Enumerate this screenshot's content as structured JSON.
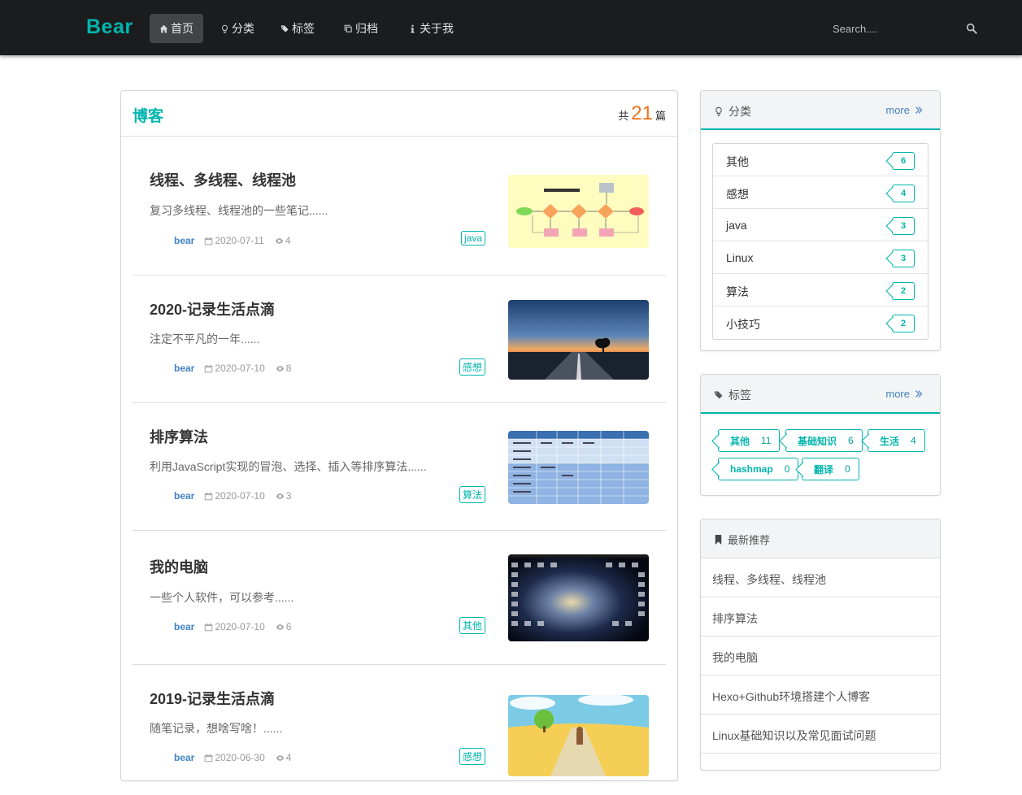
{
  "header": {
    "brand": "Bear",
    "nav": [
      {
        "label": "首页",
        "icon": "home-icon",
        "active": true
      },
      {
        "label": "分类",
        "icon": "lightbulb-icon"
      },
      {
        "label": "标签",
        "icon": "tags-icon"
      },
      {
        "label": "归档",
        "icon": "clone-icon"
      },
      {
        "label": "关于我",
        "icon": "info-icon"
      }
    ],
    "search_placeholder": "Search....",
    "search_icon": "search-icon"
  },
  "blog": {
    "title": "博客",
    "count_prefix": "共",
    "count": "21",
    "count_suffix": "篇",
    "posts": [
      {
        "title": "线程、多线程、线程池",
        "desc": "复习多线程、线程池的一些笔记......",
        "author": "bear",
        "date": "2020-07-11",
        "views": "4",
        "tag": "java",
        "thumb": "flowchart-thumbnail"
      },
      {
        "title": "2020-记录生活点滴",
        "desc": "注定不平凡的一年......",
        "author": "bear",
        "date": "2020-07-10",
        "views": "8",
        "tag": "感想",
        "thumb": "sunset-road-thumbnail"
      },
      {
        "title": "排序算法",
        "desc": "利用JavaScript实现的冒泡、选择、插入等排序算法......",
        "author": "bear",
        "date": "2020-07-10",
        "views": "3",
        "tag": "算法",
        "thumb": "table-thumbnail"
      },
      {
        "title": "我的电脑",
        "desc": "一些个人软件，可以参考......",
        "author": "bear",
        "date": "2020-07-10",
        "views": "6",
        "tag": "其他",
        "thumb": "desktop-galaxy-thumbnail"
      },
      {
        "title": "2019-记录生活点滴",
        "desc": "随笔记录，想啥写啥！......",
        "author": "bear",
        "date": "2020-06-30",
        "views": "4",
        "tag": "感想",
        "thumb": "cartoon-field-thumbnail"
      }
    ]
  },
  "categories": {
    "title": "分类",
    "more": "more",
    "items": [
      {
        "name": "其他",
        "count": "6"
      },
      {
        "name": "感想",
        "count": "4"
      },
      {
        "name": "java",
        "count": "3"
      },
      {
        "name": "Linux",
        "count": "3"
      },
      {
        "name": "算法",
        "count": "2"
      },
      {
        "name": "小技巧",
        "count": "2"
      }
    ]
  },
  "tags": {
    "title": "标签",
    "more": "more",
    "items": [
      {
        "name": "其他",
        "count": "11"
      },
      {
        "name": "基础知识",
        "count": "6"
      },
      {
        "name": "生活",
        "count": "4"
      },
      {
        "name": "hashmap",
        "count": "0"
      },
      {
        "name": "翻译",
        "count": "0"
      }
    ]
  },
  "recommend": {
    "title": "最新推荐",
    "items": [
      "线程、多线程、线程池",
      "排序算法",
      "我的电脑",
      "Hexo+Github环境搭建个人博客",
      "Linux基础知识以及常见面试问题"
    ]
  },
  "colors": {
    "accent": "#00b5ad",
    "link": "#4183c4",
    "count": "#f2711c",
    "navbar": "#1b1c1d"
  }
}
